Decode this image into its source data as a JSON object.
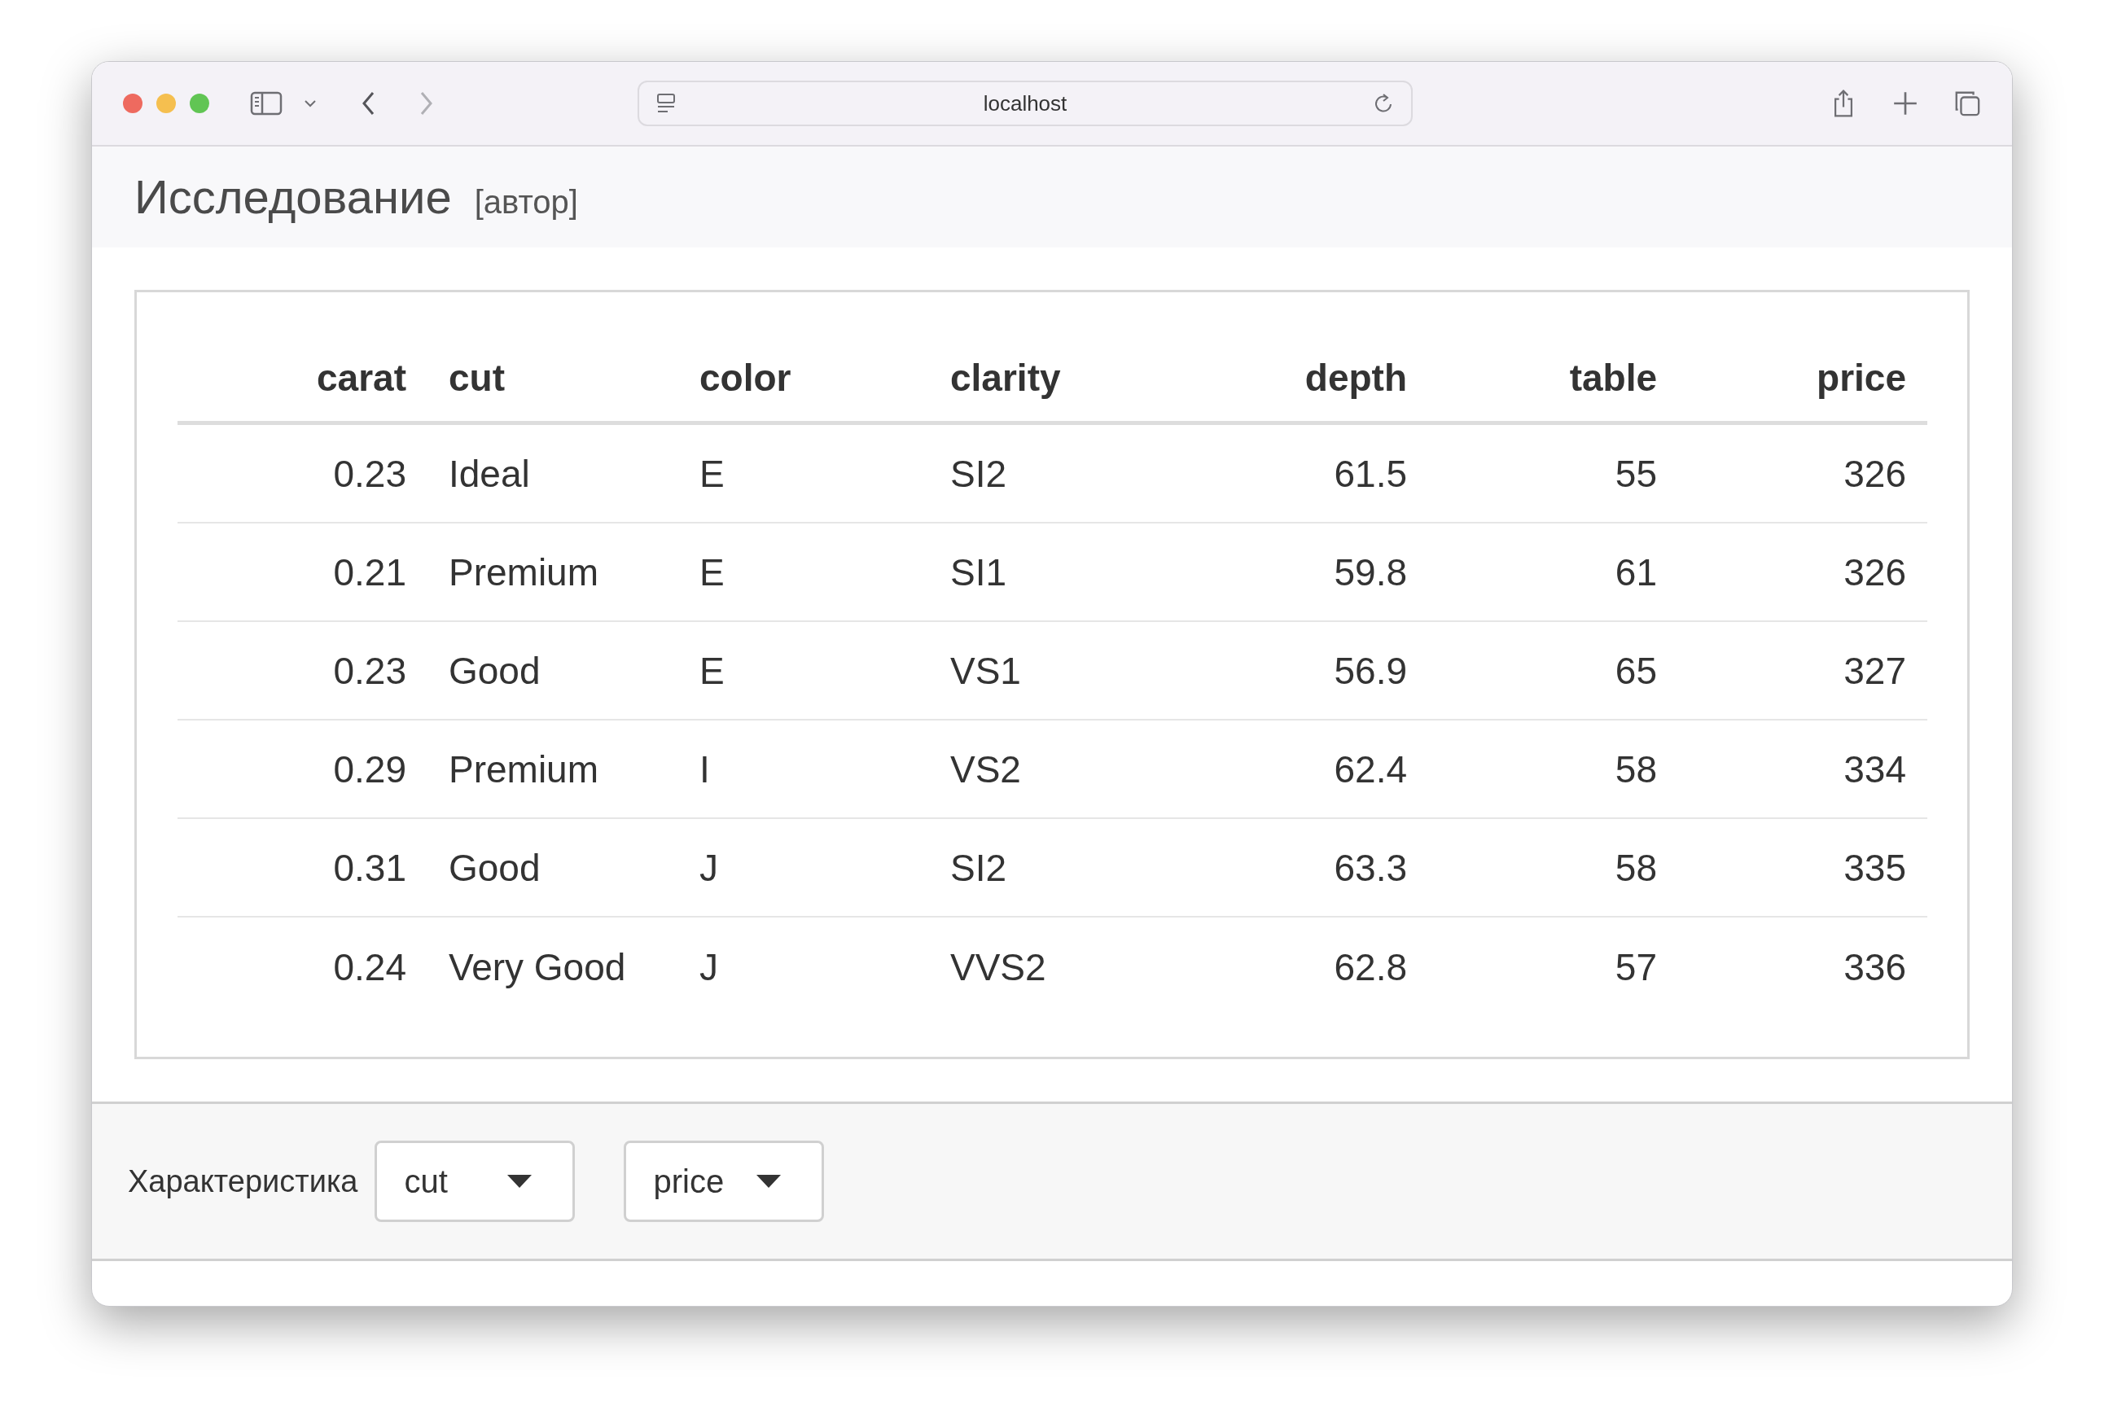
{
  "browser": {
    "address": "localhost"
  },
  "app": {
    "title": "Исследование",
    "subtitle": "[автор]"
  },
  "table": {
    "columns": [
      {
        "label": "carat",
        "kind": "number"
      },
      {
        "label": "cut",
        "kind": "text"
      },
      {
        "label": "color",
        "kind": "text"
      },
      {
        "label": "clarity",
        "kind": "text"
      },
      {
        "label": "depth",
        "kind": "number"
      },
      {
        "label": "table",
        "kind": "number"
      },
      {
        "label": "price",
        "kind": "number"
      }
    ],
    "rows": [
      [
        "0.23",
        "Ideal",
        "E",
        "SI2",
        "61.5",
        "55",
        "326"
      ],
      [
        "0.21",
        "Premium",
        "E",
        "SI1",
        "59.8",
        "61",
        "326"
      ],
      [
        "0.23",
        "Good",
        "E",
        "VS1",
        "56.9",
        "65",
        "327"
      ],
      [
        "0.29",
        "Premium",
        "I",
        "VS2",
        "62.4",
        "58",
        "334"
      ],
      [
        "0.31",
        "Good",
        "J",
        "SI2",
        "63.3",
        "58",
        "335"
      ],
      [
        "0.24",
        "Very Good",
        "J",
        "VVS2",
        "62.8",
        "57",
        "336"
      ]
    ]
  },
  "controls": {
    "label": "Характеристика",
    "selects": [
      {
        "value": "cut"
      },
      {
        "value": "price"
      }
    ]
  }
}
